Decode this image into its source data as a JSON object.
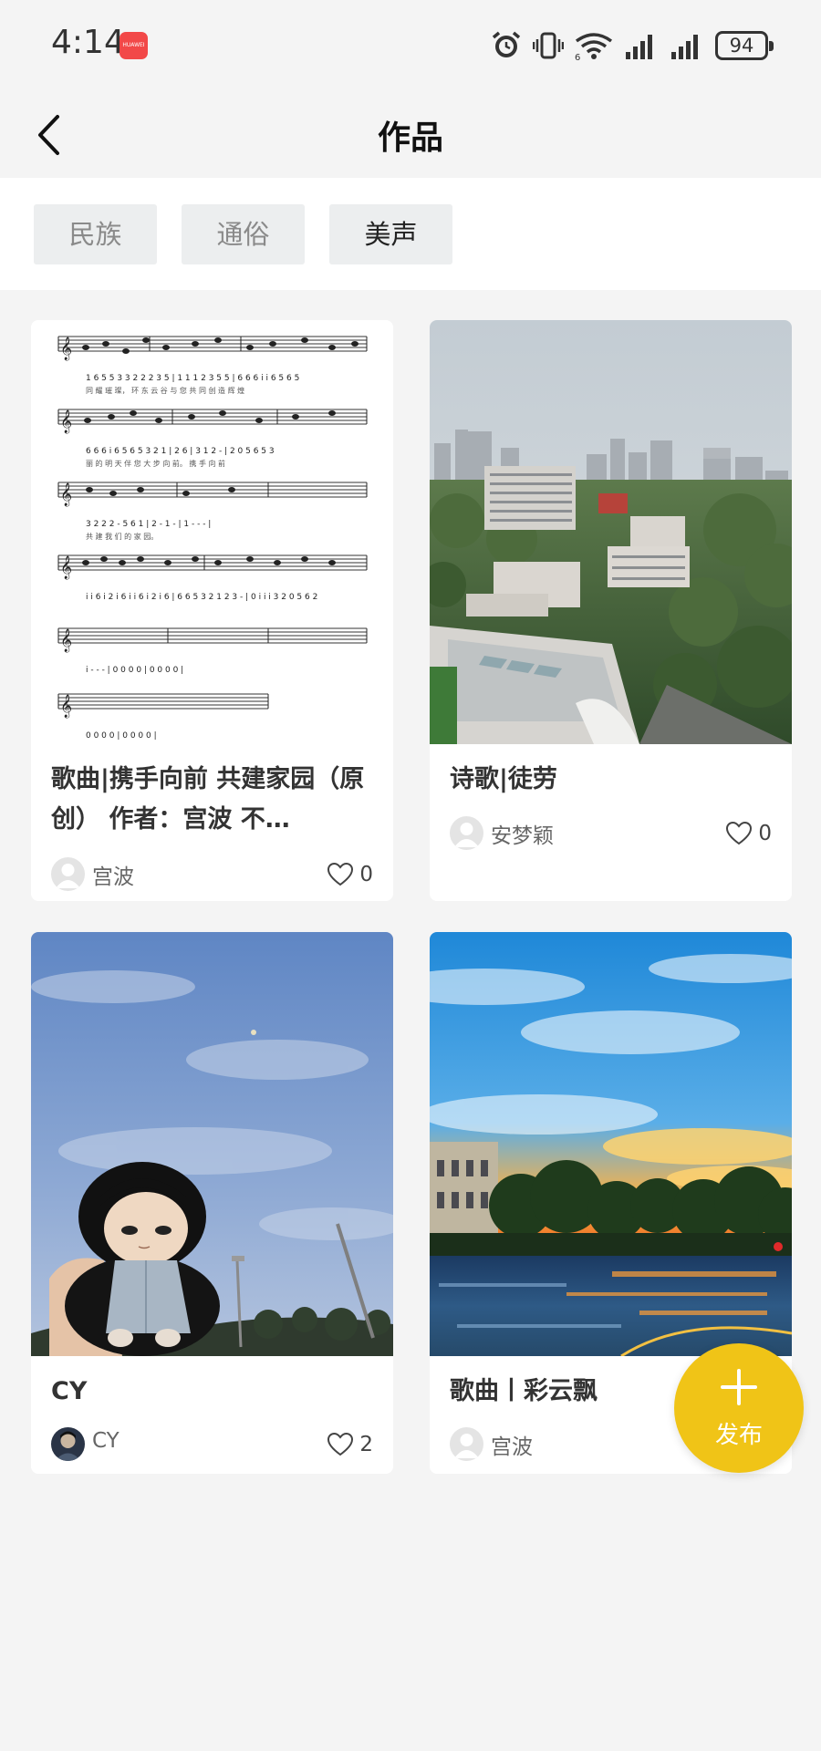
{
  "status_bar": {
    "time": "4:14",
    "app_badge": "HUAWEI",
    "battery": "94"
  },
  "header": {
    "title": "作品"
  },
  "filters": [
    {
      "label": "民族",
      "active": false
    },
    {
      "label": "通俗",
      "active": false
    },
    {
      "label": "美声",
      "active": true
    }
  ],
  "works": [
    {
      "title": "歌曲|携手向前 共建家园（原创） 作者：宫波 不…",
      "author": "宫波",
      "likes": "0",
      "image": "sheet-music"
    },
    {
      "title": "诗歌|徒劳",
      "author": "安梦颖",
      "likes": "0",
      "image": "city-skyline"
    },
    {
      "title": "CY",
      "author": "CY",
      "likes": "2",
      "image": "plush-doll-sky"
    },
    {
      "title": "歌曲丨彩云飘",
      "author": "宫波",
      "likes": "",
      "image": "sunset-square"
    }
  ],
  "fab": {
    "label": "发布",
    "icon": "plus-icon"
  },
  "colors": {
    "accent": "#f0c417",
    "background": "#f4f4f4",
    "card": "#ffffff",
    "chip": "#eceeef"
  }
}
